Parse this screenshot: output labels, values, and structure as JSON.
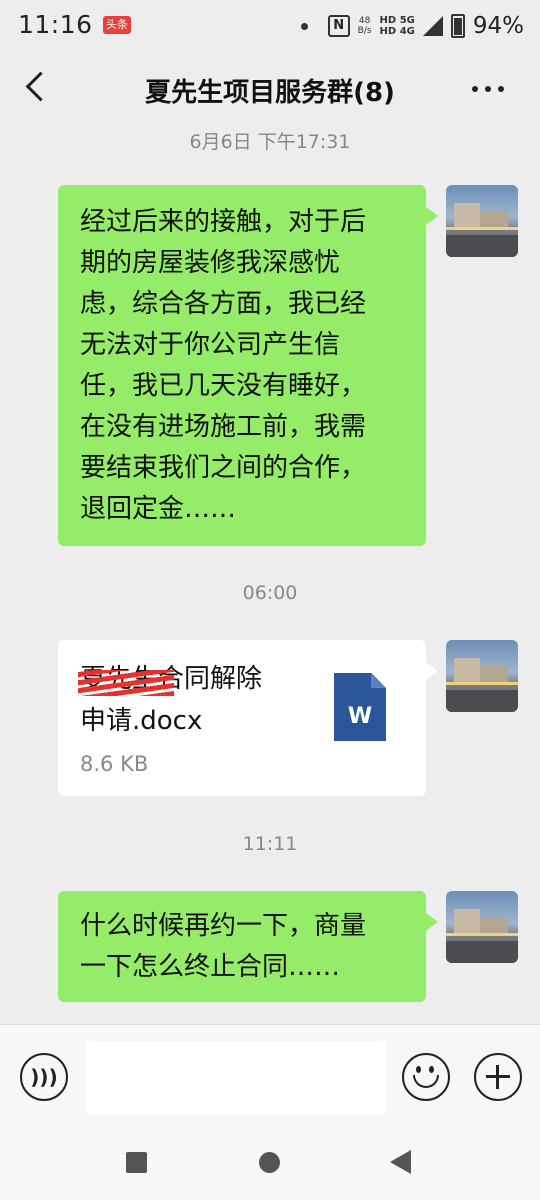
{
  "status_bar": {
    "time": "11:16",
    "badge": "头条",
    "net_speed_value": "48",
    "net_speed_unit": "B/s",
    "sim_line1": "HD 5G",
    "sim_line2": "HD 4G",
    "nfc": "N",
    "battery": "94%"
  },
  "header": {
    "title": "夏先生项目服务群(8)"
  },
  "messages": [
    {
      "type": "timestamp",
      "text": "6月6日 下午17:31"
    },
    {
      "type": "text",
      "lines": [
        "经过后来的接触，对于后",
        "期的房屋装修我深感忧",
        "虑，综合各方面，我已经",
        "无法对于你公司产生信",
        "任，我已几天没有睡好，",
        "在没有进场施工前，我需",
        "要结束我们之间的合作，",
        "退回定金……"
      ]
    },
    {
      "type": "timestamp",
      "text": "06:00"
    },
    {
      "type": "file",
      "name_line1": "夏先生合同解除",
      "name_line2": "申请.docx",
      "size": "8.6 KB",
      "icon_letter": "W"
    },
    {
      "type": "timestamp",
      "text": "11:11"
    },
    {
      "type": "text",
      "lines": [
        "什么时候再约一下，商量",
        "一下怎么终止合同……"
      ]
    }
  ],
  "colors": {
    "chat_background": "#ededed",
    "sent_bubble": "#95ec69",
    "file_bubble": "#ffffff",
    "word_icon": "#2b579a",
    "redaction": "#e8302c"
  }
}
